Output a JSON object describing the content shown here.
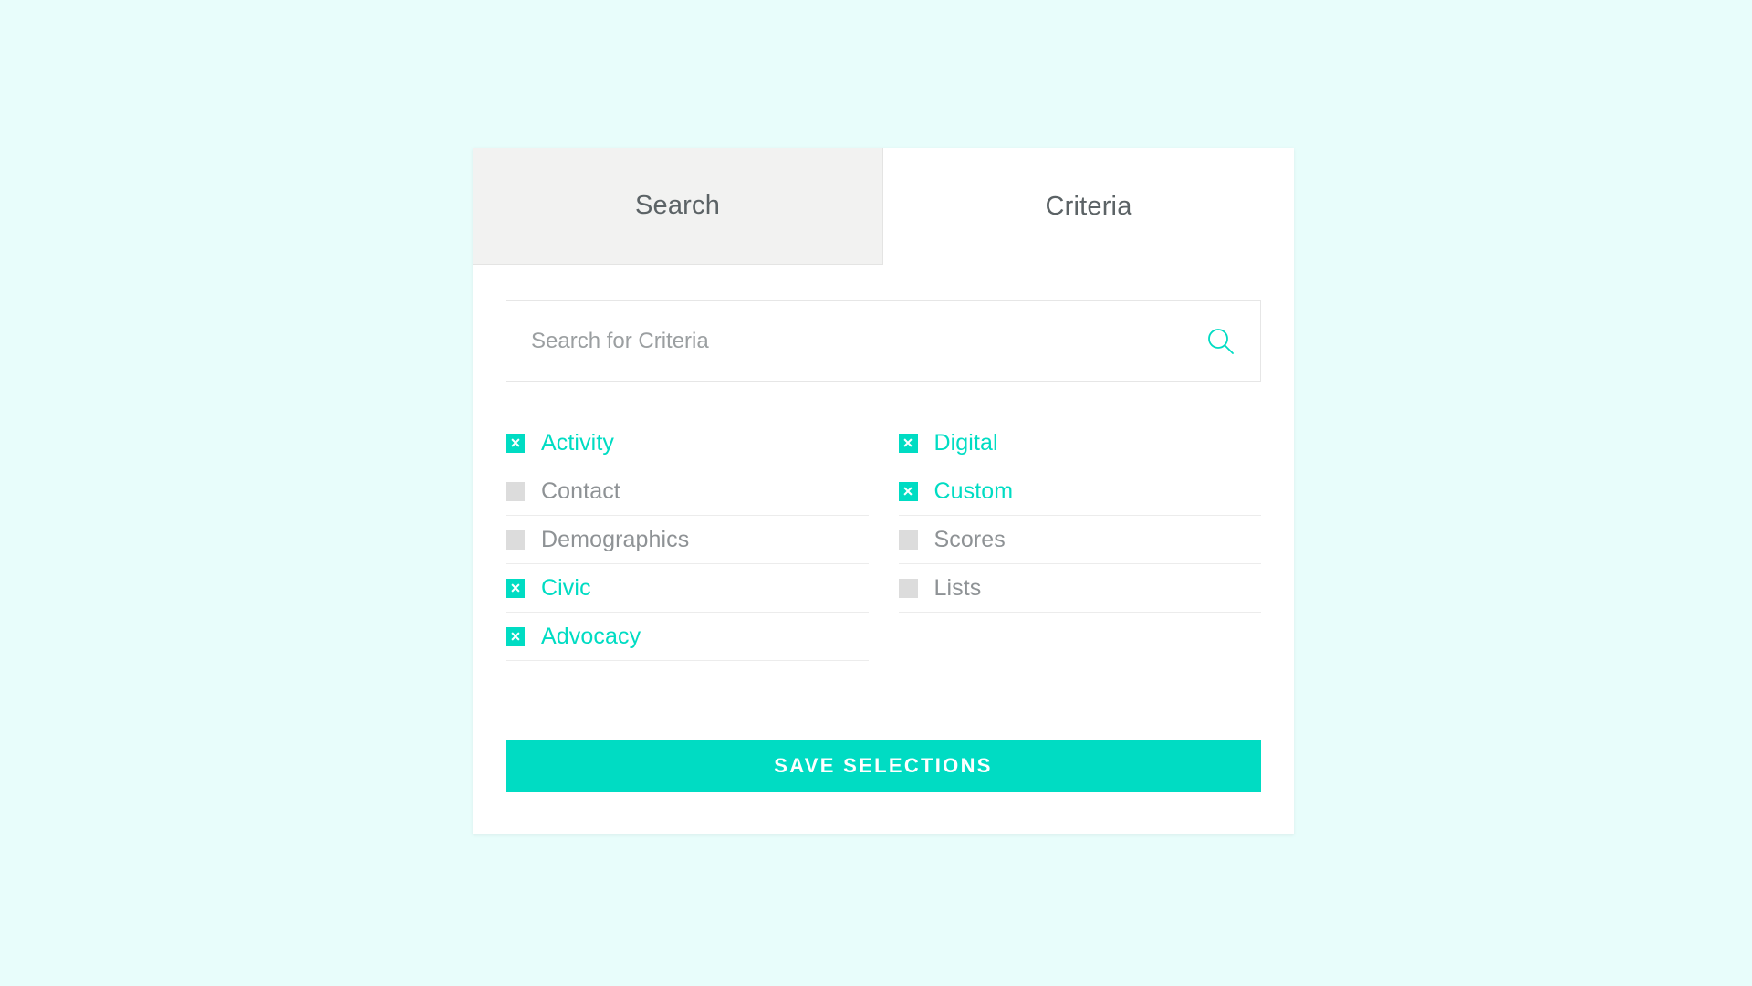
{
  "theme": {
    "page_background": "#E8FDFB",
    "accent": "#00DCC3",
    "card_background": "#FFFFFF",
    "inactive_tab_background": "#F2F2F1",
    "muted_text": "#8E9295",
    "unchecked_box": "#DCDCDC"
  },
  "tabs": [
    {
      "label": "Search",
      "active": false
    },
    {
      "label": "Criteria",
      "active": true
    }
  ],
  "search": {
    "value": "",
    "placeholder": "Search for Criteria",
    "icon": "search-icon"
  },
  "criteria": {
    "left_column": [
      {
        "label": "Activity",
        "checked": true
      },
      {
        "label": "Contact",
        "checked": false
      },
      {
        "label": "Demographics",
        "checked": false
      },
      {
        "label": "Civic",
        "checked": true
      },
      {
        "label": "Advocacy",
        "checked": true
      }
    ],
    "right_column": [
      {
        "label": "Digital",
        "checked": true
      },
      {
        "label": "Custom",
        "checked": true
      },
      {
        "label": "Scores",
        "checked": false
      },
      {
        "label": "Lists",
        "checked": false
      }
    ]
  },
  "actions": {
    "save_label": "SAVE SELECTIONS"
  }
}
